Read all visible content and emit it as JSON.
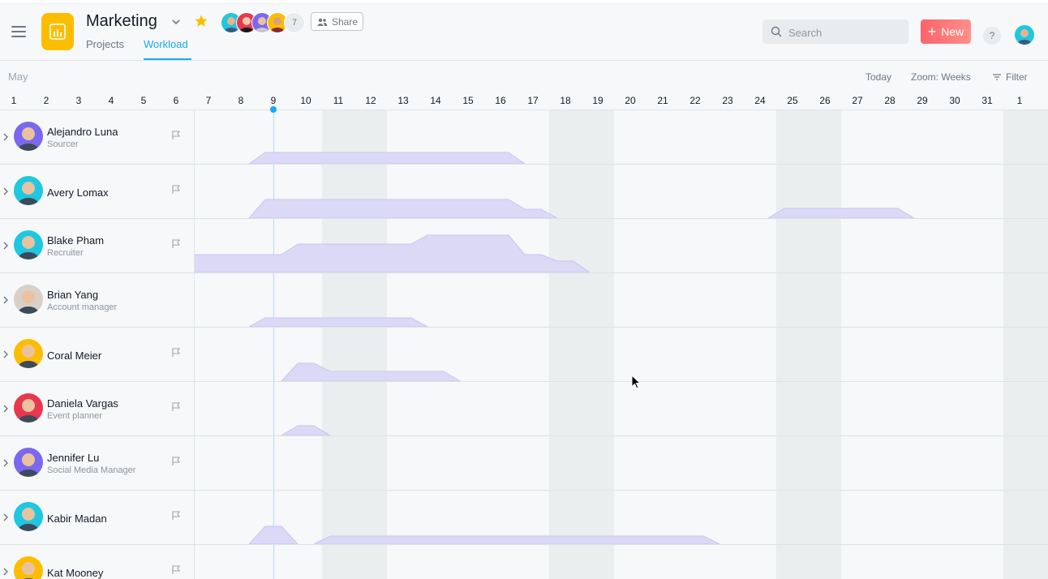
{
  "header": {
    "project_title": "Marketing",
    "tabs": [
      {
        "label": "Projects"
      },
      {
        "label": "Workload"
      }
    ],
    "active_tab": "Workload",
    "member_count": "7",
    "share_label": "Share",
    "search_placeholder": "Search",
    "new_label": "New",
    "help_label": "?",
    "colors": {
      "accent": "#14aaf5",
      "new_button": "#fc636b",
      "project_icon": "#fcbd01",
      "star": "#fcbd01"
    }
  },
  "toolbar": {
    "month": "May",
    "today_label": "Today",
    "zoom_label": "Zoom: Weeks",
    "filter_label": "Filter"
  },
  "days": [
    "1",
    "2",
    "3",
    "4",
    "5",
    "6",
    "7",
    "8",
    "9",
    "10",
    "11",
    "12",
    "13",
    "14",
    "15",
    "16",
    "17",
    "18",
    "19",
    "20",
    "21",
    "22",
    "23",
    "24",
    "25",
    "26",
    "27",
    "28",
    "29",
    "30",
    "31",
    "1"
  ],
  "today_day": "9",
  "people": [
    {
      "name": "Alejandro Luna",
      "role": "Sourcer",
      "has_flag": true,
      "avatar_color": "#7b68ee"
    },
    {
      "name": "Avery Lomax",
      "role": "",
      "has_flag": true,
      "avatar_color": "#1fc7e0"
    },
    {
      "name": "Blake Pham",
      "role": "Recruiter",
      "has_flag": true,
      "avatar_color": "#1fc7e0"
    },
    {
      "name": "Brian Yang",
      "role": "Account manager",
      "has_flag": false,
      "avatar_color": "#d9d0c8"
    },
    {
      "name": "Coral Meier",
      "role": "",
      "has_flag": true,
      "avatar_color": "#fcbd01"
    },
    {
      "name": "Daniela Vargas",
      "role": "Event planner",
      "has_flag": true,
      "avatar_color": "#e8384f"
    },
    {
      "name": "Jennifer Lu",
      "role": "Social Media Manager",
      "has_flag": true,
      "avatar_color": "#7b68ee"
    },
    {
      "name": "Kabir Madan",
      "role": "",
      "has_flag": true,
      "avatar_color": "#1fc7e0"
    },
    {
      "name": "Kat Mooney",
      "role": "",
      "has_flag": true,
      "avatar_color": "#fcbd01"
    }
  ]
}
